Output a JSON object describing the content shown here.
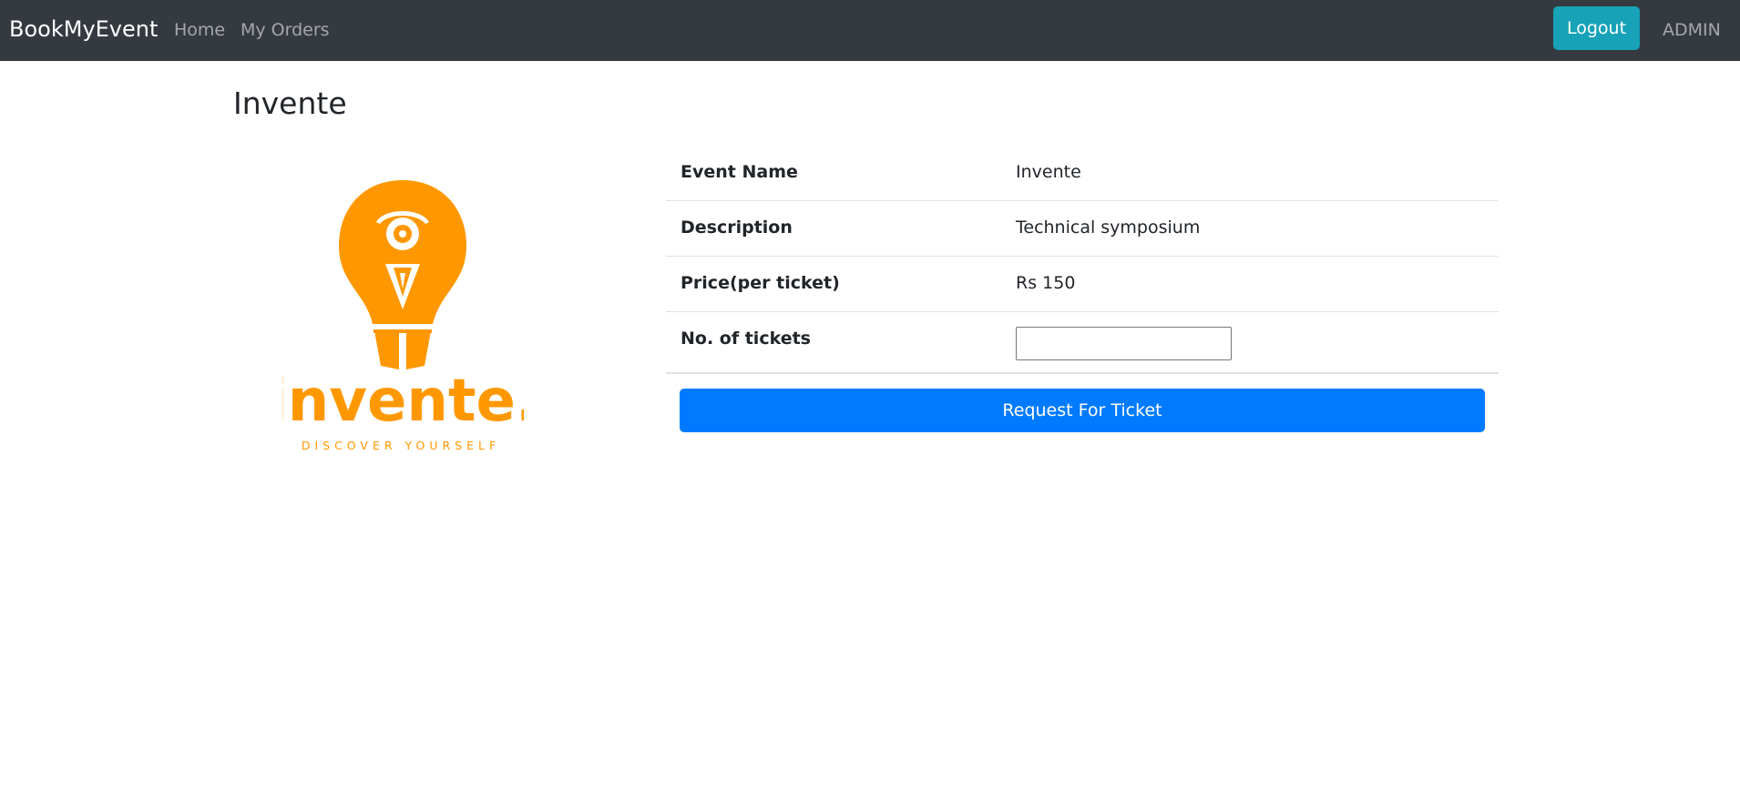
{
  "navbar": {
    "brand": "BookMyEvent",
    "links": [
      "Home",
      "My Orders"
    ],
    "logout_label": "Logout",
    "user_label": "ADMIN"
  },
  "page": {
    "title": "Invente"
  },
  "logo": {
    "icon": "lightbulb-logo",
    "wordmark": "invente.",
    "tagline": "DISCOVER YOURSELF",
    "color": "#ff9800"
  },
  "details": [
    {
      "label": "Event Name",
      "value": "Invente"
    },
    {
      "label": "Description",
      "value": "Technical symposium"
    },
    {
      "label": "Price(per ticket)",
      "value": "Rs 150"
    },
    {
      "label": "No. of tickets",
      "value": ""
    }
  ],
  "quantity_input": {
    "value": "",
    "placeholder": ""
  },
  "request_button": {
    "label": "Request For Ticket"
  },
  "colors": {
    "navbar_bg": "#343a40",
    "logout_bg": "#17a2b8",
    "primary": "#007bff",
    "logo_orange": "#ff9800"
  }
}
